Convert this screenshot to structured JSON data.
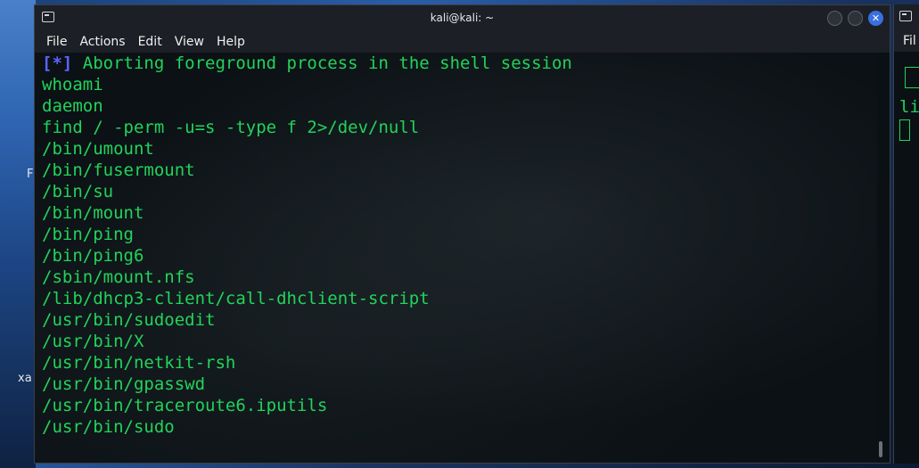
{
  "desktop": {
    "label_f": "F",
    "label_xa": "xa"
  },
  "window": {
    "title": "kali@kali: ~",
    "close_glyph": "✕",
    "menu": [
      "File",
      "Actions",
      "Edit",
      "View",
      "Help"
    ]
  },
  "terminal": {
    "first_line": {
      "marker": "[*]",
      "text": " Aborting foreground process in the shell session"
    },
    "lines": [
      "whoami",
      "daemon",
      "find / -perm -u=s -type f 2>/dev/null",
      "/bin/umount",
      "/bin/fusermount",
      "/bin/su",
      "/bin/mount",
      "/bin/ping",
      "/bin/ping6",
      "/sbin/mount.nfs",
      "/lib/dhcp3-client/call-dhclient-script",
      "/usr/bin/sudoedit",
      "/usr/bin/X",
      "/usr/bin/netkit-rsh",
      "/usr/bin/gpasswd",
      "/usr/bin/traceroute6.iputils",
      "/usr/bin/sudo"
    ]
  },
  "window2": {
    "menu_partial": "Fil",
    "text_partial": "li"
  }
}
